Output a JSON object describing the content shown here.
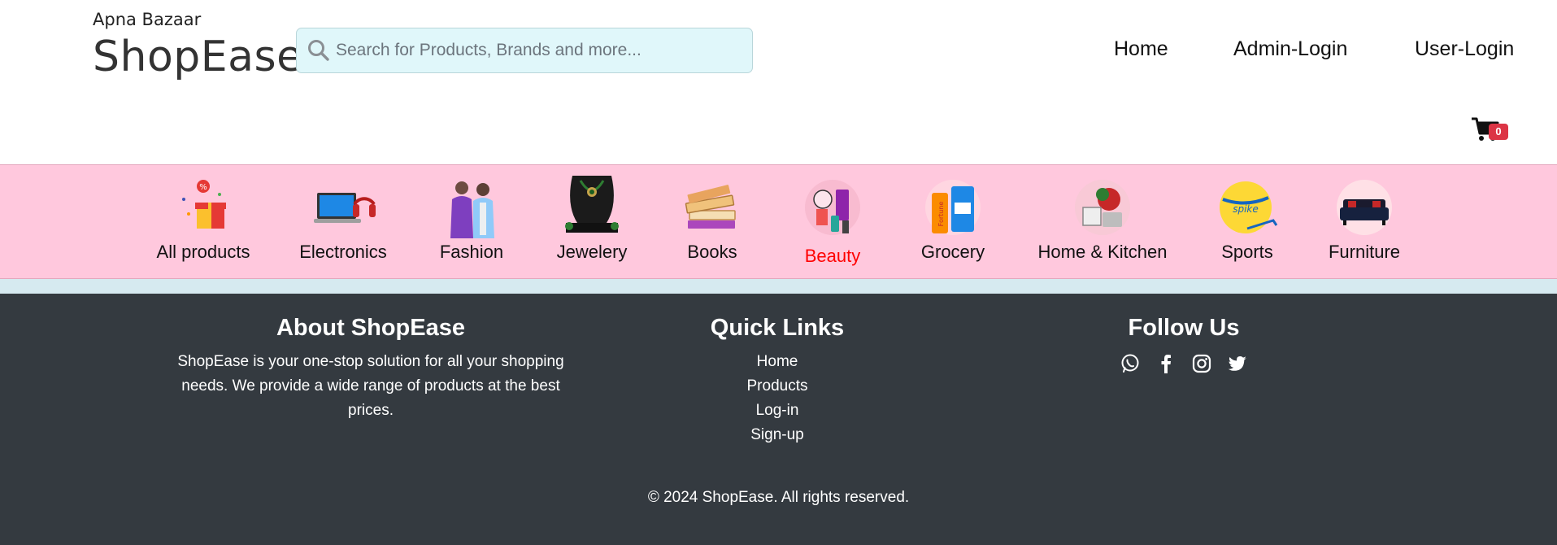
{
  "header": {
    "tagline": "Apna Bazaar",
    "brand": "ShopEase",
    "search": {
      "placeholder": "Search for Products, Brands and more..."
    },
    "nav": [
      {
        "label": "Home"
      },
      {
        "label": "Admin-Login"
      },
      {
        "label": "User-Login"
      }
    ],
    "cart": {
      "count": "0",
      "icon": "cart-icon"
    }
  },
  "categories": [
    {
      "label": "All products",
      "icon": "gift-icon"
    },
    {
      "label": "Electronics",
      "icon": "laptop-icon"
    },
    {
      "label": "Fashion",
      "icon": "fashion-couple-image"
    },
    {
      "label": "Jewelery",
      "icon": "necklace-icon"
    },
    {
      "label": "Books",
      "icon": "books-icon"
    },
    {
      "label": "Beauty",
      "icon": "beauty-products-image",
      "active": true
    },
    {
      "label": "Grocery",
      "icon": "grocery-image"
    },
    {
      "label": "Home & Kitchen",
      "icon": "home-kitchen-image"
    },
    {
      "label": "Sports",
      "icon": "ball-icon"
    },
    {
      "label": "Furniture",
      "icon": "sofa-icon"
    }
  ],
  "footer": {
    "about": {
      "title": "About ShopEase",
      "text": "ShopEase is your one-stop solution for all your shopping needs. We provide a wide range of products at the best prices."
    },
    "quick_links": {
      "title": "Quick Links",
      "items": [
        "Home",
        "Products",
        "Log-in",
        "Sign-up"
      ]
    },
    "follow": {
      "title": "Follow Us",
      "icons": [
        "whatsapp-icon",
        "facebook-icon",
        "instagram-icon",
        "twitter-icon"
      ]
    },
    "copyright": "© 2024 ShopEase. All rights reserved."
  },
  "colors": {
    "category_bar": "#ffc8dd",
    "search_bg": "#e0f7fa",
    "footer_bg": "#343a40",
    "badge": "#dc3545",
    "active_category": "#ff0000"
  }
}
